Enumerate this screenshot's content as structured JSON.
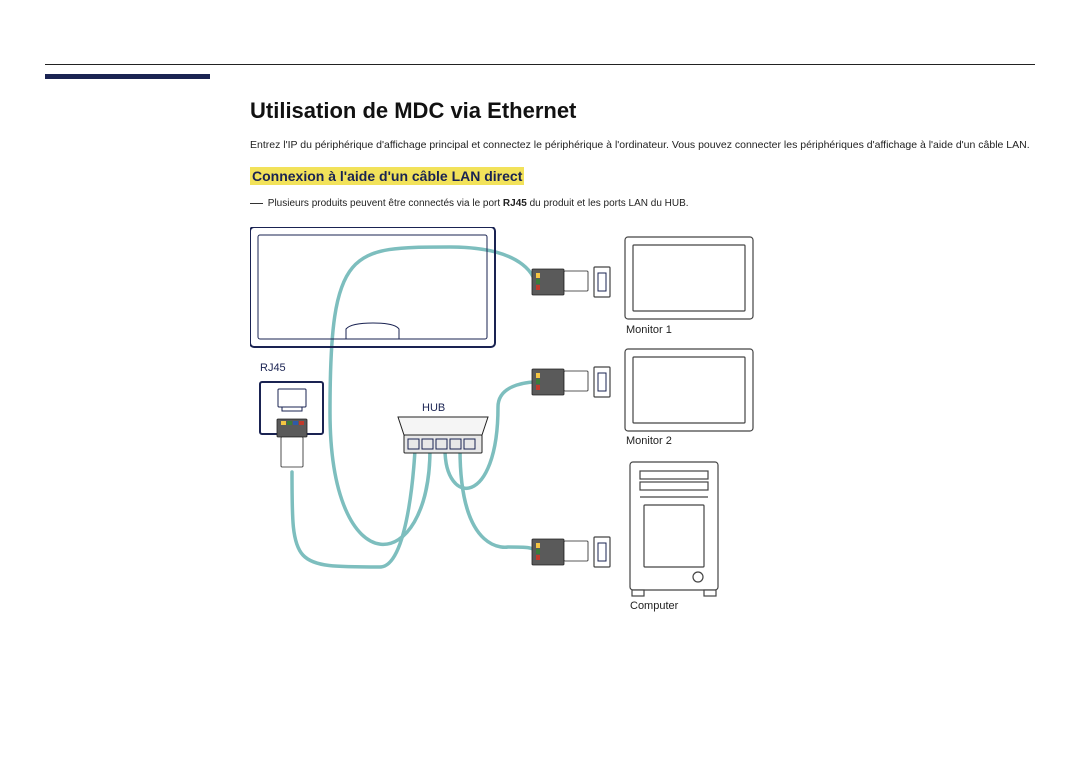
{
  "title": "Utilisation de MDC via Ethernet",
  "intro": "Entrez l'IP du périphérique d'affichage principal et connectez le périphérique à l'ordinateur. Vous pouvez connecter les périphériques d'affichage à l'aide d'un câble LAN.",
  "subheading": "Connexion à l'aide d'un câble LAN direct",
  "note_prefix": "―",
  "note_text_pre": "Plusieurs produits peuvent être connectés via le port ",
  "note_bold": "RJ45",
  "note_text_post": " du produit et les ports LAN du HUB.",
  "labels": {
    "rj45": "RJ45",
    "hub": "HUB",
    "monitor1": "Monitor 1",
    "monitor2": "Monitor 2",
    "computer": "Computer"
  }
}
